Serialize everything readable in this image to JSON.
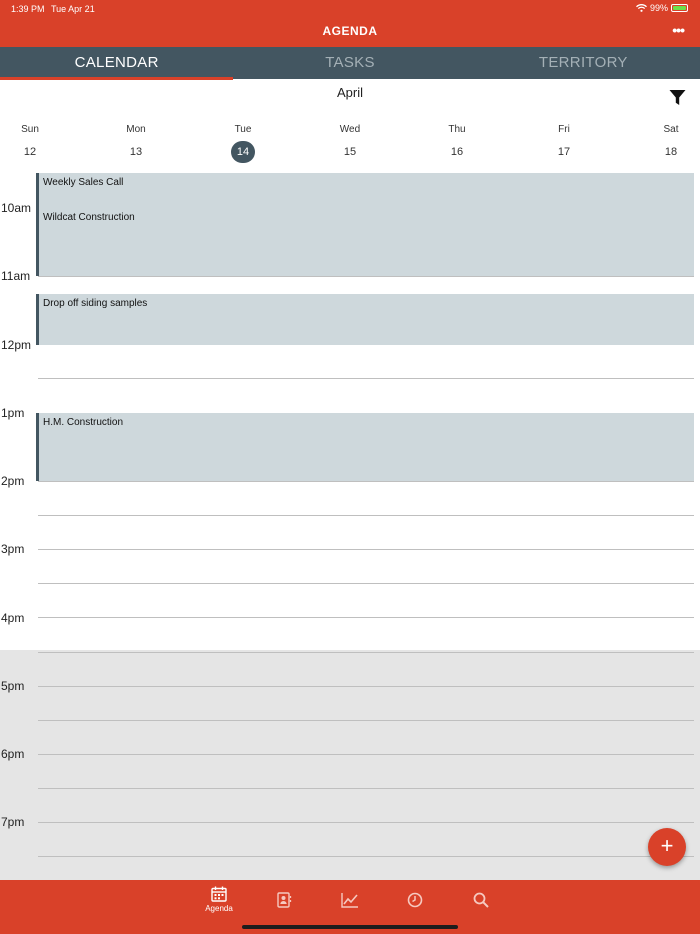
{
  "status": {
    "time": "1:39 PM",
    "date": "Tue Apr 21",
    "battery": "99%",
    "battery_level": 0.99
  },
  "header": {
    "title": "AGENDA",
    "more_icon": "ellipsis-icon"
  },
  "tabs": [
    {
      "label": "CALENDAR",
      "active": true
    },
    {
      "label": "TASKS",
      "active": false
    },
    {
      "label": "TERRITORY",
      "active": false
    }
  ],
  "calendar": {
    "month": "April",
    "filter_icon": "filter-icon",
    "days": [
      {
        "name": "Sun",
        "num": "12"
      },
      {
        "name": "Mon",
        "num": "13"
      },
      {
        "name": "Tue",
        "num": "14",
        "selected": true
      },
      {
        "name": "Wed",
        "num": "15"
      },
      {
        "name": "Thu",
        "num": "16"
      },
      {
        "name": "Fri",
        "num": "17"
      },
      {
        "name": "Sat",
        "num": "18"
      }
    ],
    "hours": [
      "10am",
      "11am",
      "12pm",
      "1pm",
      "2pm",
      "3pm",
      "4pm",
      "5pm",
      "6pm",
      "7pm"
    ],
    "events": [
      {
        "title": "Weekly Sales Call",
        "start": "9:30am",
        "end": "10:00am"
      },
      {
        "title": "Wildcat Construction",
        "start": "10:00am",
        "end": "11:00am"
      },
      {
        "title": "Drop off siding samples",
        "start": "11:15am",
        "end": "12:00pm"
      },
      {
        "title": "H.M. Construction",
        "start": "1:00pm",
        "end": "2:00pm"
      }
    ]
  },
  "fab": {
    "label": "+"
  },
  "bottom_nav": [
    {
      "icon": "calendar-icon",
      "label": "Agenda",
      "active": true
    },
    {
      "icon": "contacts-icon",
      "label": ""
    },
    {
      "icon": "chart-icon",
      "label": ""
    },
    {
      "icon": "clock-icon",
      "label": ""
    },
    {
      "icon": "search-icon",
      "label": ""
    }
  ],
  "colors": {
    "primary": "#d94129",
    "tab_bar": "#435661",
    "event_bg": "#ced8dc",
    "event_accent": "#435661"
  }
}
